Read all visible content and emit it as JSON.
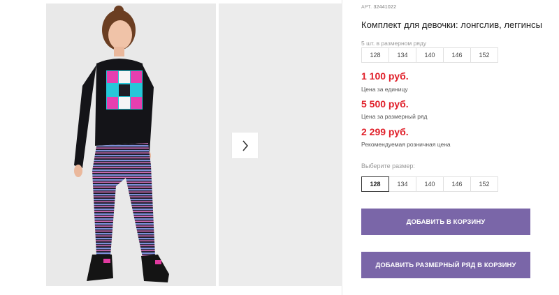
{
  "product": {
    "art_label": "АРТ.",
    "art_value": "32441022",
    "title": "Комплект для девочки: лонгслив, леггинсы"
  },
  "size_range": {
    "caption": "5 шт. в размерном ряду",
    "sizes": [
      "128",
      "134",
      "140",
      "146",
      "152"
    ]
  },
  "prices": [
    {
      "value": "1 100 руб.",
      "label": "Цена за единицу"
    },
    {
      "value": "5 500 руб.",
      "label": "Цена за размерный ряд"
    },
    {
      "value": "2 299 руб.",
      "label": "Рекомендуемая розничная цена"
    }
  ],
  "size_select": {
    "label": "Выберите размер:",
    "sizes": [
      "128",
      "134",
      "140",
      "146",
      "152"
    ],
    "selected": "128"
  },
  "buttons": {
    "add_to_cart": "ДОБАВИТЬ В КОРЗИНУ",
    "add_range_to_cart": "ДОБАВИТЬ РАЗМЕРНЫЙ РЯД В КОРЗИНУ"
  },
  "colors": {
    "price": "#e0202a",
    "button": "#7a66a8"
  },
  "icons": {
    "next": "chevron-right-icon"
  }
}
